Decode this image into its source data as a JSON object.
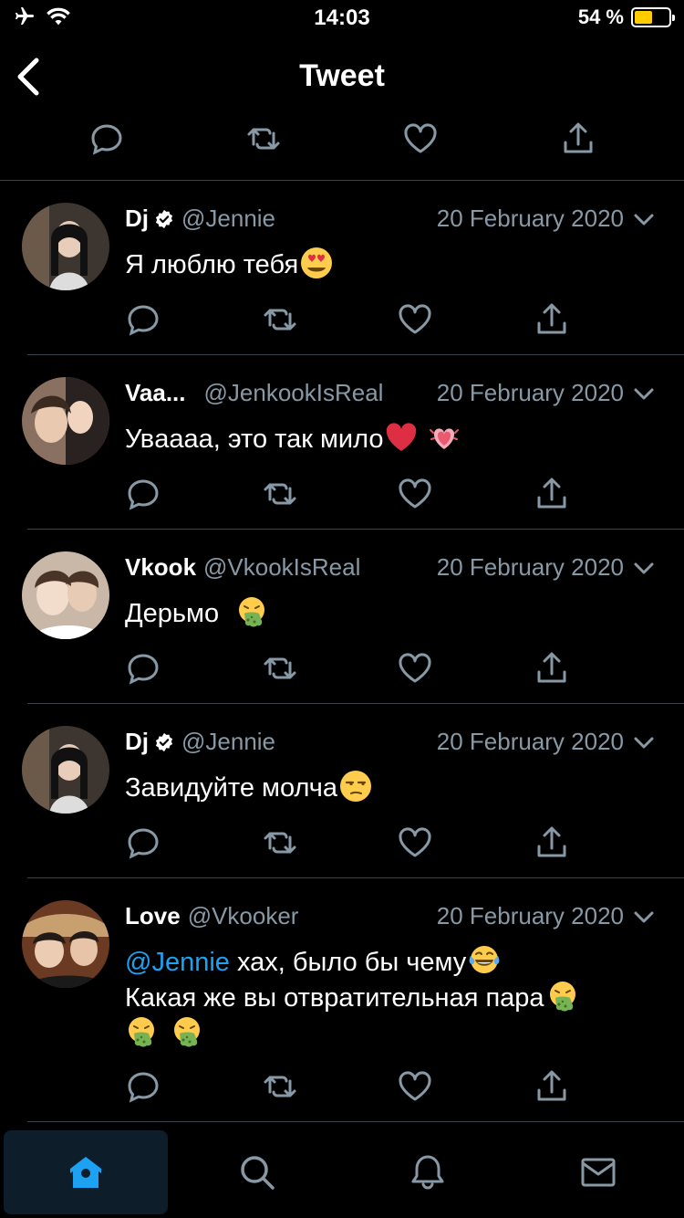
{
  "status_bar": {
    "time": "14:03",
    "battery_text": "54 %",
    "battery_level": 0.54,
    "battery_color": "#ffcc00"
  },
  "nav": {
    "title": "Tweet"
  },
  "colors": {
    "accent": "#1da1f2",
    "secondary_text": "#8899a6",
    "divider": "#38444d"
  },
  "tweets": [
    {
      "name": "Dj",
      "verified": true,
      "handle": "@Jennie",
      "date": "20 February 2020",
      "text_lines": [
        "Я люблю тебя"
      ],
      "emojis": [
        "heart-eyes-emoji"
      ]
    },
    {
      "name": "Vaa...",
      "verified": false,
      "handle": "@JenkookIsReal",
      "date": "20 February 2020",
      "text_lines": [
        "Увaaaa, это так мило"
      ],
      "emojis": [
        "red-heart-emoji",
        "beating-heart-emoji"
      ]
    },
    {
      "name": "Vkook",
      "verified": false,
      "handle": "@VkookIsReal",
      "date": "20 February 2020",
      "text_lines": [
        "Дерьмо "
      ],
      "emojis": [
        "vomiting-face-emoji"
      ]
    },
    {
      "name": "Dj",
      "verified": true,
      "handle": "@Jennie",
      "date": "20 February 2020",
      "text_lines": [
        "Завидуйте молча"
      ],
      "emojis": [
        "unamused-face-emoji"
      ]
    },
    {
      "name": "Love",
      "verified": false,
      "handle": "@Vkooker",
      "date": "20 February 2020",
      "mention": "@Jennie",
      "line1_rest": " хах, было бы чему",
      "line2": "Какая же вы отвратительная пара",
      "emojis": [
        "tears-of-joy-emoji",
        "vomiting-face-emoji",
        "vomiting-face-emoji",
        "vomiting-face-emoji"
      ]
    }
  ],
  "tabbar": {
    "items": [
      "home-icon",
      "search-icon",
      "notifications-icon",
      "messages-icon"
    ],
    "active": "home-icon"
  }
}
